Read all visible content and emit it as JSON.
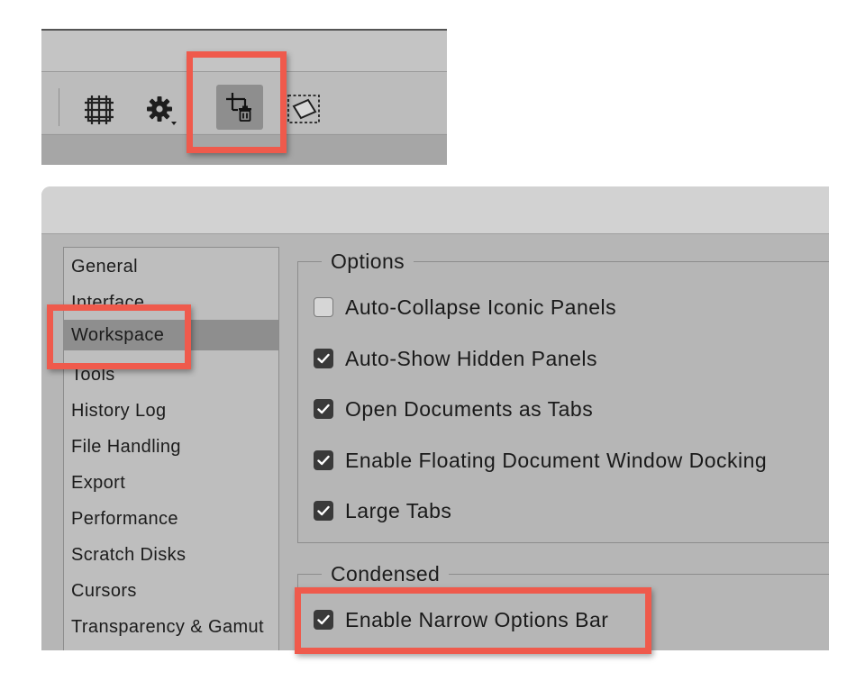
{
  "toolbar": {
    "icons": [
      "grid-icon",
      "gear-dropdown-icon",
      "crop-delete-icon",
      "perspective-crop-icon"
    ],
    "selected_icon": "crop-delete-icon"
  },
  "preferences": {
    "nav": {
      "items": [
        {
          "label": "General"
        },
        {
          "label": "Interface"
        },
        {
          "label": "Workspace"
        },
        {
          "label": "Tools"
        },
        {
          "label": "History Log"
        },
        {
          "label": "File Handling"
        },
        {
          "label": "Export"
        },
        {
          "label": "Performance"
        },
        {
          "label": "Scratch Disks"
        },
        {
          "label": "Cursors"
        },
        {
          "label": "Transparency & Gamut"
        }
      ],
      "selected": "Workspace"
    },
    "options": {
      "legend": "Options",
      "items": [
        {
          "label": "Auto-Collapse Iconic Panels",
          "checked": false
        },
        {
          "label": "Auto-Show Hidden Panels",
          "checked": true
        },
        {
          "label": "Open Documents as Tabs",
          "checked": true
        },
        {
          "label": "Enable Floating Document Window Docking",
          "checked": true
        },
        {
          "label": "Large Tabs",
          "checked": true
        }
      ]
    },
    "condensed": {
      "legend": "Condensed",
      "items": [
        {
          "label": "Enable Narrow Options Bar",
          "checked": true
        }
      ]
    }
  },
  "colors": {
    "highlight": "#ef5a4c",
    "panel_bg": "#b6b6b6",
    "selected_row": "#8e8e8e",
    "checkbox_on": "#3a3a3a"
  }
}
